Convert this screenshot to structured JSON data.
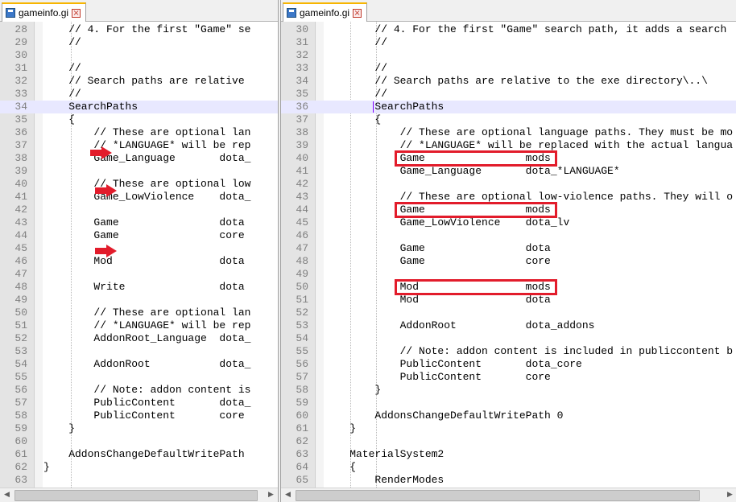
{
  "left": {
    "tab_title": "gameinfo.gi",
    "lines": [
      {
        "n": "28",
        "code": "    // 4. For the first \"Game\" se"
      },
      {
        "n": "29",
        "code": "    //"
      },
      {
        "n": "30",
        "code": ""
      },
      {
        "n": "31",
        "code": "    //"
      },
      {
        "n": "32",
        "code": "    // Search paths are relative"
      },
      {
        "n": "33",
        "code": "    //"
      },
      {
        "n": "34",
        "code": "    SearchPaths",
        "current": true
      },
      {
        "n": "35",
        "code": "    {"
      },
      {
        "n": "36",
        "code": "        // These are optional lan"
      },
      {
        "n": "37",
        "code": "        // *LANGUAGE* will be rep"
      },
      {
        "n": "38",
        "code": "        Game_Language       dota_"
      },
      {
        "n": "39",
        "code": ""
      },
      {
        "n": "40",
        "code": "        // These are optional low"
      },
      {
        "n": "41",
        "code": "        Game_LowViolence    dota_"
      },
      {
        "n": "42",
        "code": ""
      },
      {
        "n": "43",
        "code": "        Game                dota"
      },
      {
        "n": "44",
        "code": "        Game                core"
      },
      {
        "n": "45",
        "code": ""
      },
      {
        "n": "46",
        "code": "        Mod                 dota"
      },
      {
        "n": "47",
        "code": ""
      },
      {
        "n": "48",
        "code": "        Write               dota"
      },
      {
        "n": "49",
        "code": ""
      },
      {
        "n": "50",
        "code": "        // These are optional lan"
      },
      {
        "n": "51",
        "code": "        // *LANGUAGE* will be rep"
      },
      {
        "n": "52",
        "code": "        AddonRoot_Language  dota_"
      },
      {
        "n": "53",
        "code": ""
      },
      {
        "n": "54",
        "code": "        AddonRoot           dota_"
      },
      {
        "n": "55",
        "code": ""
      },
      {
        "n": "56",
        "code": "        // Note: addon content is"
      },
      {
        "n": "57",
        "code": "        PublicContent       dota_"
      },
      {
        "n": "58",
        "code": "        PublicContent       core"
      },
      {
        "n": "59",
        "code": "    }"
      },
      {
        "n": "60",
        "code": ""
      },
      {
        "n": "61",
        "code": "    AddonsChangeDefaultWritePath"
      },
      {
        "n": "62",
        "code": "}"
      },
      {
        "n": "63",
        "code": ""
      }
    ]
  },
  "right": {
    "tab_title": "gameinfo.gi",
    "lines": [
      {
        "n": "30",
        "code": "        // 4. For the first \"Game\" search path, it adds a search"
      },
      {
        "n": "31",
        "code": "        //"
      },
      {
        "n": "32",
        "code": ""
      },
      {
        "n": "33",
        "code": "        //"
      },
      {
        "n": "34",
        "code": "        // Search paths are relative to the exe directory\\..\\"
      },
      {
        "n": "35",
        "code": "        //"
      },
      {
        "n": "36",
        "code": "        SearchPaths",
        "current": true
      },
      {
        "n": "37",
        "code": "        {"
      },
      {
        "n": "38",
        "code": "            // These are optional language paths. They must be mo"
      },
      {
        "n": "39",
        "code": "            // *LANGUAGE* will be replaced with the actual langua"
      },
      {
        "n": "40",
        "code": "            Game                mods"
      },
      {
        "n": "41",
        "code": "            Game_Language       dota_*LANGUAGE*"
      },
      {
        "n": "42",
        "code": ""
      },
      {
        "n": "43",
        "code": "            // These are optional low-violence paths. They will o"
      },
      {
        "n": "44",
        "code": "            Game                mods"
      },
      {
        "n": "45",
        "code": "            Game_LowViolence    dota_lv"
      },
      {
        "n": "46",
        "code": ""
      },
      {
        "n": "47",
        "code": "            Game                dota"
      },
      {
        "n": "48",
        "code": "            Game                core"
      },
      {
        "n": "49",
        "code": ""
      },
      {
        "n": "50",
        "code": "            Mod                 mods"
      },
      {
        "n": "51",
        "code": "            Mod                 dota"
      },
      {
        "n": "52",
        "code": ""
      },
      {
        "n": "53",
        "code": "            AddonRoot           dota_addons"
      },
      {
        "n": "54",
        "code": ""
      },
      {
        "n": "55",
        "code": "            // Note: addon content is included in publiccontent b"
      },
      {
        "n": "56",
        "code": "            PublicContent       dota_core"
      },
      {
        "n": "57",
        "code": "            PublicContent       core"
      },
      {
        "n": "58",
        "code": "        }"
      },
      {
        "n": "59",
        "code": ""
      },
      {
        "n": "60",
        "code": "        AddonsChangeDefaultWritePath 0"
      },
      {
        "n": "61",
        "code": "    }"
      },
      {
        "n": "62",
        "code": ""
      },
      {
        "n": "63",
        "code": "    MaterialSystem2"
      },
      {
        "n": "64",
        "code": "    {"
      },
      {
        "n": "65",
        "code": "        RenderModes"
      }
    ]
  },
  "highlights": [
    {
      "line": "40",
      "text": "Game mods"
    },
    {
      "line": "44",
      "text": "Game mods"
    },
    {
      "line": "50",
      "text": "Mod mods"
    }
  ],
  "annotation_color": "#e21c2b",
  "current_line_color": "#e8e8ff"
}
